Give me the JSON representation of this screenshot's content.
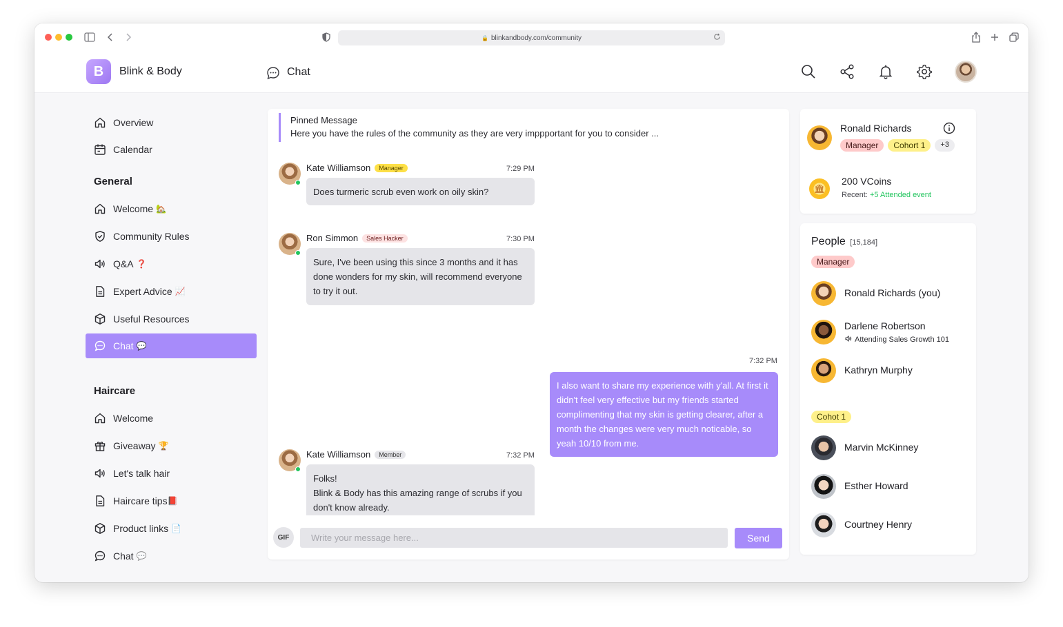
{
  "browser": {
    "url": "blinkandbody.com/community"
  },
  "header": {
    "brand": "Blink & Body",
    "logo_letter": "B",
    "page_title": "Chat"
  },
  "sidebar": {
    "top_items": [
      {
        "label": "Overview"
      },
      {
        "label": "Calendar"
      }
    ],
    "general": {
      "title": "General",
      "items": [
        {
          "label": "Welcome",
          "emoji": "🏡"
        },
        {
          "label": "Community Rules",
          "emoji": ""
        },
        {
          "label": "Q&A",
          "emoji": "❓"
        },
        {
          "label": "Expert Advice",
          "emoji": "📈"
        },
        {
          "label": "Useful Resources",
          "emoji": ""
        },
        {
          "label": "Chat",
          "emoji": "💬"
        }
      ]
    },
    "haircare": {
      "title": "Haircare",
      "items": [
        {
          "label": "Welcome",
          "emoji": ""
        },
        {
          "label": "Giveaway",
          "emoji": "🏆"
        },
        {
          "label": "Let's talk hair",
          "emoji": ""
        },
        {
          "label": "Haircare tips",
          "emoji": "📕"
        },
        {
          "label": "Product links",
          "emoji": "📄"
        },
        {
          "label": "Chat",
          "emoji": "💬"
        }
      ]
    }
  },
  "chat": {
    "pinned": {
      "title": "Pinned Message",
      "text": "Here you have the rules of the community as they are very imppportant for you to consider ..."
    },
    "messages": [
      {
        "author": "Kate Williamson",
        "badge": "Manager",
        "time": "7:29 PM",
        "text": "Does turmeric scrub even work on oily skin?"
      },
      {
        "author": "Ron Simmon",
        "badge": "Sales Hacker",
        "time": "7:30 PM",
        "text": "Sure, I've been using this since 3 months and it has done wonders for my skin, will recommend everyone to try it out."
      },
      {
        "author": "Kate Williamson",
        "badge": "Member",
        "time": "7:32 PM",
        "line1": "Folks!",
        "line2": "Blink & Body has this amazing range of scrubs if you don't know already."
      }
    ],
    "my_message": {
      "time": "7:32 PM",
      "text": "I also want to share my experience with y'all. At first it didn't feel very effective but my friends started complimenting that my skin is getting clearer, after a month the changes were very much noticable, so yeah 10/10 from me."
    },
    "composer": {
      "gif_label": "GIF",
      "placeholder": "Write your message here...",
      "send_label": "Send"
    }
  },
  "profile_card": {
    "name": "Ronald Richards",
    "tags": [
      "Manager",
      "Cohort 1",
      "+3"
    ],
    "vcoins": "200 VCoins",
    "recent_label": "Recent:",
    "recent_value": "+5 Attended event"
  },
  "people": {
    "title": "People",
    "count": "[15,184]",
    "groups": [
      {
        "label": "Manager",
        "members": [
          {
            "name": "Ronald Richards (you)",
            "sub": ""
          },
          {
            "name": "Darlene Robertson",
            "sub": "Attending Sales Growth 101"
          },
          {
            "name": "Kathryn Murphy",
            "sub": ""
          }
        ]
      },
      {
        "label": "Cohot 1",
        "members": [
          {
            "name": "Marvin McKinney",
            "sub": ""
          },
          {
            "name": "Esther Howard",
            "sub": ""
          },
          {
            "name": "Courtney Henry",
            "sub": ""
          }
        ]
      }
    ]
  },
  "colors": {
    "accent": "#a78bfa",
    "manager_badge": "#fde047",
    "manager_pill": "#fecaca",
    "cohort_pill": "#fef08a",
    "online": "#22c55e",
    "recent_green": "#22c55e"
  }
}
